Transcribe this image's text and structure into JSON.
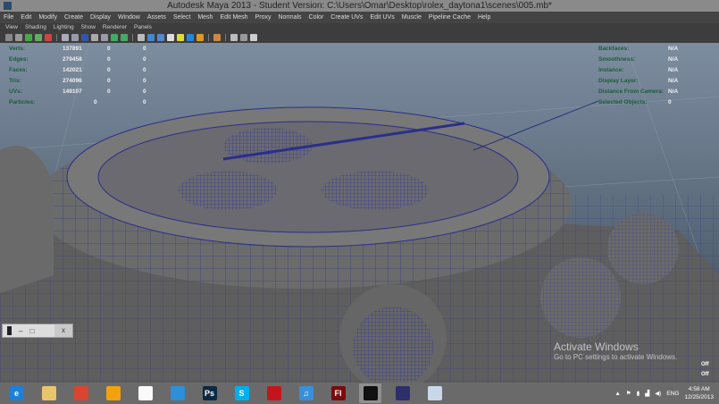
{
  "window": {
    "title": "Autodesk Maya 2013 - Student Version: C:\\Users\\Omar\\Desktop\\rolex_daytona1\\scenes\\005.mb*"
  },
  "menu": [
    "File",
    "Edit",
    "Modify",
    "Create",
    "Display",
    "Window",
    "Assets",
    "Select",
    "Mesh",
    "Edit Mesh",
    "Proxy",
    "Normals",
    "Color",
    "Create UVs",
    "Edit UVs",
    "Muscle",
    "Pipeline Cache",
    "Help"
  ],
  "panel_menu": [
    "View",
    "Shading",
    "Lighting",
    "Show",
    "Renderer",
    "Panels"
  ],
  "hud_left": [
    {
      "label": "Verts:",
      "v1": "137891",
      "v2": "0",
      "v3": "0"
    },
    {
      "label": "Edges:",
      "v1": "279458",
      "v2": "0",
      "v3": "0"
    },
    {
      "label": "Faces:",
      "v1": "142021",
      "v2": "0",
      "v3": "0"
    },
    {
      "label": "Tris:",
      "v1": "274096",
      "v2": "0",
      "v3": "0"
    },
    {
      "label": "UVs:",
      "v1": "149107",
      "v2": "0",
      "v3": "0"
    },
    {
      "label": "Particles:",
      "v1": "",
      "v2": "0",
      "v3": "0"
    }
  ],
  "hud_right": [
    {
      "label": "Backfaces:",
      "value": "N/A"
    },
    {
      "label": "Smoothness:",
      "value": "N/A"
    },
    {
      "label": "Instance:",
      "value": "N/A"
    },
    {
      "label": "Display Layer:",
      "value": "N/A"
    },
    {
      "label": "Distance From Camera:",
      "value": "N/A"
    },
    {
      "label": "Selected Objects:",
      "value": "0"
    }
  ],
  "hud_bottom": {
    "a": "Off",
    "b": "Off"
  },
  "watermark": {
    "title": "Activate Windows",
    "subtitle": "Go to PC settings to activate Windows."
  },
  "taskbar": {
    "apps": [
      {
        "name": "internet-explorer",
        "label": "e",
        "color": "#1e7fd8"
      },
      {
        "name": "file-explorer",
        "label": "",
        "color": "#e9c46a"
      },
      {
        "name": "chrome",
        "label": "",
        "color": "#d9442f"
      },
      {
        "name": "maya-launcher",
        "label": "",
        "color": "#f2a20c"
      },
      {
        "name": "document",
        "label": "",
        "color": "#fafafa"
      },
      {
        "name": "app-blue",
        "label": "",
        "color": "#2d8fd8"
      },
      {
        "name": "photoshop",
        "label": "Ps",
        "color": "#0b2942"
      },
      {
        "name": "skype",
        "label": "S",
        "color": "#00aff0"
      },
      {
        "name": "creative-cloud",
        "label": "",
        "color": "#c3161c"
      },
      {
        "name": "itunes",
        "label": "♫",
        "color": "#3a8fd9"
      },
      {
        "name": "flash",
        "label": "Fl",
        "color": "#7a0c0c"
      },
      {
        "name": "maya",
        "label": "",
        "color": "#111"
      },
      {
        "name": "mudbox",
        "label": "",
        "color": "#2d2f6b"
      },
      {
        "name": "paint",
        "label": "",
        "color": "#c8d8e8"
      }
    ],
    "lang": "ENG",
    "time": "4:58 AM",
    "date": "12/25/2013"
  }
}
